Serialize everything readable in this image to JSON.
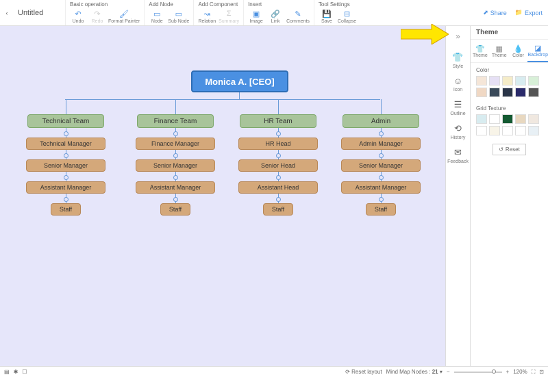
{
  "title": "Untitled",
  "toolbar": {
    "groups": {
      "basic": {
        "title": "Basic operation",
        "undo": "Undo",
        "redo": "Redo",
        "format_painter": "Format Painter"
      },
      "add_node": {
        "title": "Add Node",
        "node": "Node",
        "sub_node": "Sub Node"
      },
      "add_component": {
        "title": "Add Component",
        "relation": "Relation",
        "summary": "Summary"
      },
      "insert": {
        "title": "Insert",
        "image": "Image",
        "link": "Link",
        "comments": "Comments"
      },
      "tool_settings": {
        "title": "Tool Settings",
        "save": "Save",
        "collapse": "Collapse"
      }
    },
    "share": "Share",
    "export": "Export"
  },
  "chart": {
    "ceo": "Monica A. [CEO]",
    "cols": [
      {
        "dept": "Technical Team",
        "m1": "Technical Manager",
        "m2": "Senior Manager",
        "m3": "Assistant Manager",
        "staff": "Staff"
      },
      {
        "dept": "Finance Team",
        "m1": "Finance Manager",
        "m2": "Senior Manager",
        "m3": "Assistant Manager",
        "staff": "Staff"
      },
      {
        "dept": "HR Team",
        "m1": "HR Head",
        "m2": "Senior Head",
        "m3": "Assistant Head",
        "staff": "Staff"
      },
      {
        "dept": "Admin",
        "m1": "Admin Manager",
        "m2": "Senior Manager",
        "m3": "Assistant Manager",
        "staff": "Staff"
      }
    ]
  },
  "side": {
    "style": "Style",
    "icon": "Icon",
    "outline": "Outline",
    "history": "History",
    "feedback": "Feedback"
  },
  "theme": {
    "title": "Theme",
    "tabs": {
      "theme": "Theme",
      "theme2": "Theme",
      "color": "Color",
      "backdrop": "Backdrop"
    },
    "color_label": "Color",
    "grid_label": "Grid Texture",
    "reset": "Reset",
    "colors_row1": [
      "#f5e6d8",
      "#e6e0f5",
      "#f5ecc8",
      "#d8ecf0",
      "#d8f0d8"
    ],
    "colors_row2": [
      "#f0d8c4",
      "#3a4a5a",
      "#2a3548",
      "#2a2a6a",
      "#555555"
    ],
    "grid_row1": [
      "#d8ecf0",
      "#ffffff",
      "#145a32",
      "#e8d8c0",
      "#f0e8e0"
    ],
    "grid_row2": [
      "#ffffff",
      "#f8f4e8",
      "#ffffff",
      "#ffffff",
      "#e8f0f5"
    ]
  },
  "status": {
    "reset_layout": "Reset layout",
    "nodes_label": "Mind Map Nodes :",
    "nodes_count": "21",
    "zoom": "120%"
  }
}
